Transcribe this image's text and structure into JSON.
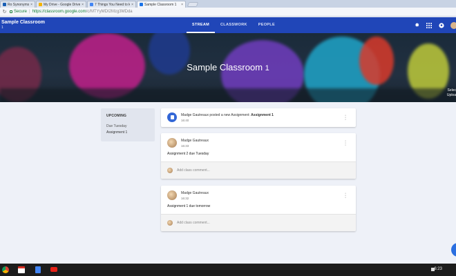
{
  "browser": {
    "tabs": [
      {
        "label": "Ro Synonyms, Spe",
        "color": "#1a5fb4",
        "active": false
      },
      {
        "label": "My Drive - Google Drive",
        "color": "#f4b400",
        "active": false
      },
      {
        "label": "7 Things You Need to k",
        "color": "#4285f4",
        "active": false
      },
      {
        "label": "Sample Classroom 1",
        "color": "#1a73e8",
        "active": true
      }
    ],
    "secure_label": "Secure",
    "url_host": "https://classroom.google.com",
    "url_path": "/c/MTYyMDI2Mzg3MDda"
  },
  "app": {
    "class_name": "Sample Classroom",
    "class_section": "1",
    "nav": [
      {
        "label": "STREAM",
        "active": true
      },
      {
        "label": "CLASSWORK",
        "active": false
      },
      {
        "label": "PEOPLE",
        "active": false
      }
    ],
    "icons": [
      "gear-icon",
      "apps-grid-icon",
      "notifications-icon",
      "account-avatar"
    ]
  },
  "banner": {
    "title": "Sample Classroom",
    "section": "1",
    "note_line1": "Selec",
    "note_line2": "Uploa"
  },
  "upcoming": {
    "title": "UPCOMING",
    "due_label": "Due Tuesday",
    "item": "Assignment 1"
  },
  "stream": {
    "announcement": {
      "text": "Madge Gautreaux posted a new Assignment: ",
      "assignment": "Assignment 1",
      "time": "16:40"
    },
    "posts": [
      {
        "author": "Madge Gautreaux",
        "time": "16:33",
        "body": "Assignment 2 due Tuesday",
        "comment_placeholder": "Add class comment..."
      },
      {
        "author": "Madge Gautreaux",
        "time": "16:32",
        "body": "Assignment 1 due tomorrow",
        "comment_placeholder": "Add class comment..."
      }
    ]
  },
  "shelf": {
    "clock": "6:23",
    "apps": [
      "chrome-icon",
      "gmail-icon",
      "docs-icon",
      "youtube-icon"
    ]
  },
  "colors": {
    "app_bar": "#2046b8",
    "accent": "#3367d6"
  }
}
